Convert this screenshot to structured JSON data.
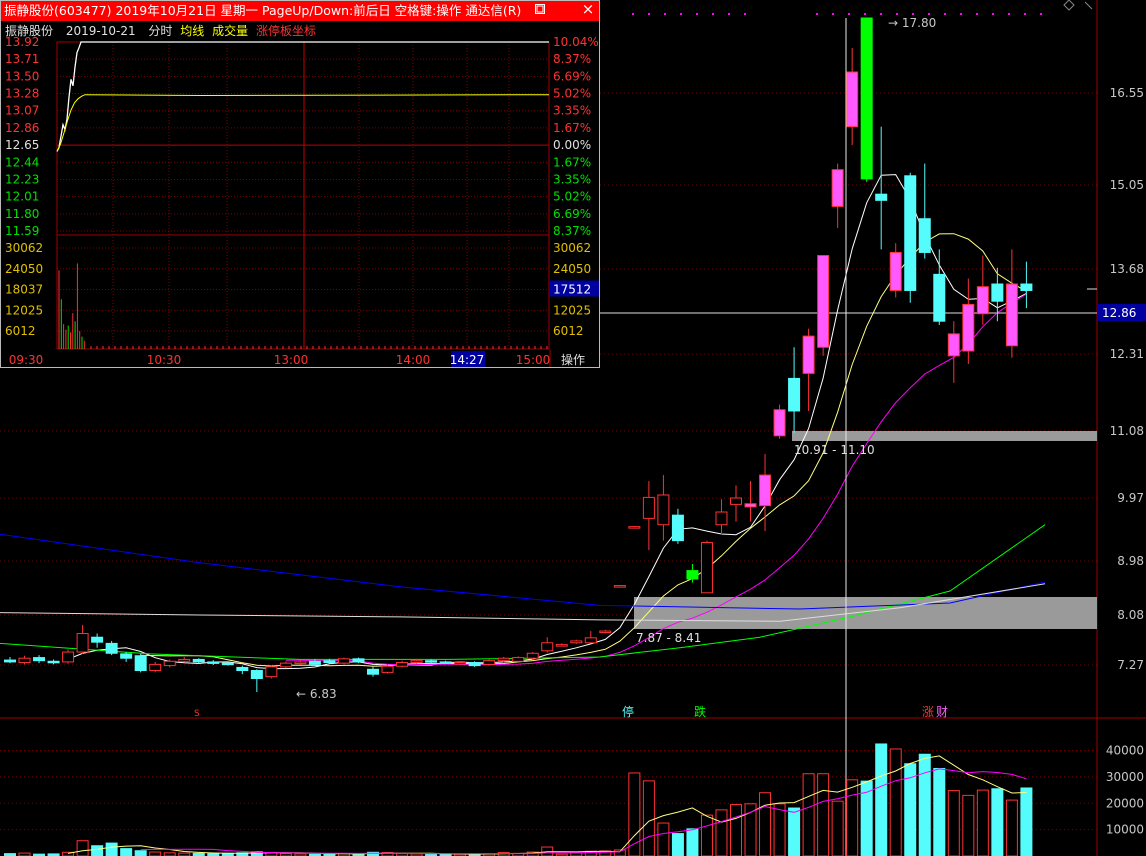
{
  "colors": {
    "up": "#ff3232",
    "up_fill": "#ff5aff",
    "down": "#54fcfc",
    "limit_up": "#00ff00",
    "grid": "#7a0000",
    "ma_white": "#ffffff",
    "ma_yellow": "#ffff80",
    "ma_magenta": "#ff00ff",
    "ma_green": "#00ff00",
    "ma_blue": "#0000ff",
    "axis_text": "#c8c8c8",
    "price_label_bg": "#0000a0",
    "zone_fill": "#9a9a9a"
  },
  "intraday": {
    "title": "振静股份(603477) 2019年10月21日 星期一 PageUp/Down:前后日 空格键:操作 通达信(R)",
    "min_icon": "restore-icon",
    "close_icon": "×",
    "subtitle": {
      "name": "振静股份",
      "date": "2019-10-21",
      "mode": "分时",
      "avg_line": "均线",
      "volume": "成交量",
      "limit_board": "涨停板坐标"
    },
    "prices_left": [
      "13.92",
      "13.71",
      "13.50",
      "13.28",
      "13.07",
      "12.86",
      "12.65",
      "12.44",
      "12.23",
      "12.01",
      "11.80",
      "11.59"
    ],
    "pcts_right": [
      "10.04%",
      "8.37%",
      "6.69%",
      "5.02%",
      "3.35%",
      "1.67%",
      "0.00%",
      "1.67%",
      "3.35%",
      "5.02%",
      "6.69%",
      "8.37%"
    ],
    "vol_left": [
      "30062",
      "24050",
      "18037",
      "12025",
      "6012"
    ],
    "vol_right": [
      "30062",
      "24050",
      "18037",
      "12025",
      "6012"
    ],
    "vol_cursor": "17512",
    "times": [
      "09:30",
      "10:30",
      "13:00",
      "14:00",
      "14:27",
      "15:00"
    ],
    "operate": "操作",
    "price_path": [
      12.57,
      12.62,
      12.76,
      12.9,
      12.84,
      12.97,
      13.24,
      13.46,
      13.38,
      13.61,
      13.79,
      13.85,
      13.92
    ],
    "avg_path": [
      12.57,
      12.66,
      12.8,
      12.95,
      13.08,
      13.17,
      13.22,
      13.25,
      13.27
    ],
    "vol_bars": [
      28500,
      18000,
      9000,
      7000,
      8500,
      6000,
      13000,
      10000,
      31000,
      6500,
      4500,
      3000
    ]
  },
  "kline": {
    "price_axis": [
      "16.55",
      "15.05",
      "13.68",
      "12.31",
      "11.08",
      "9.97",
      "8.98",
      "8.08",
      "7.27"
    ],
    "current_price": "12.86",
    "high_label": "17.80",
    "low_label": "6.83",
    "zone_upper_label": "10.91 - 11.10",
    "zone_lower_label": "7.87 - 8.41",
    "markers": [
      {
        "text": "S",
        "color": "#ff3232"
      },
      {
        "text": "停",
        "color": "#54fcfc"
      },
      {
        "text": "跌",
        "color": "#00ff00"
      },
      {
        "text": "涨",
        "color": "#ff3232"
      },
      {
        "text": "财",
        "color": "#ff5aff"
      }
    ],
    "volume_axis": [
      "40000",
      "30000",
      "20000",
      "10000"
    ],
    "candles": [
      {
        "o": 7.35,
        "c": 7.32,
        "h": 7.4,
        "l": 7.3
      },
      {
        "o": 7.31,
        "c": 7.38,
        "h": 7.42,
        "l": 7.28
      },
      {
        "o": 7.39,
        "c": 7.34,
        "h": 7.43,
        "l": 7.3
      },
      {
        "o": 7.33,
        "c": 7.31,
        "h": 7.36,
        "l": 7.28
      },
      {
        "o": 7.32,
        "c": 7.48,
        "h": 7.52,
        "l": 7.29
      },
      {
        "o": 7.48,
        "c": 7.78,
        "h": 7.92,
        "l": 7.45
      },
      {
        "o": 7.72,
        "c": 7.64,
        "h": 7.78,
        "l": 7.55
      },
      {
        "o": 7.62,
        "c": 7.46,
        "h": 7.66,
        "l": 7.43
      },
      {
        "o": 7.45,
        "c": 7.38,
        "h": 7.48,
        "l": 7.32
      },
      {
        "o": 7.42,
        "c": 7.18,
        "h": 7.45,
        "l": 7.15
      },
      {
        "o": 7.18,
        "c": 7.28,
        "h": 7.32,
        "l": 7.15
      },
      {
        "o": 7.26,
        "c": 7.33,
        "h": 7.36,
        "l": 7.23
      },
      {
        "o": 7.33,
        "c": 7.36,
        "h": 7.4,
        "l": 7.31
      },
      {
        "o": 7.36,
        "c": 7.32,
        "h": 7.38,
        "l": 7.29
      },
      {
        "o": 7.32,
        "c": 7.3,
        "h": 7.35,
        "l": 7.27
      },
      {
        "o": 7.3,
        "c": 7.29,
        "h": 7.33,
        "l": 7.26
      },
      {
        "o": 7.23,
        "c": 7.18,
        "h": 7.26,
        "l": 7.12
      },
      {
        "o": 7.18,
        "c": 7.05,
        "h": 7.2,
        "l": 6.83
      },
      {
        "o": 7.08,
        "c": 7.24,
        "h": 7.27,
        "l": 7.05
      },
      {
        "o": 7.24,
        "c": 7.3,
        "h": 7.33,
        "l": 7.22
      },
      {
        "o": 7.3,
        "c": 7.32,
        "h": 7.35,
        "l": 7.27
      },
      {
        "o": 7.33,
        "c": 7.28,
        "h": 7.36,
        "l": 7.26
      },
      {
        "o": 7.34,
        "c": 7.31,
        "h": 7.37,
        "l": 7.29
      },
      {
        "o": 7.3,
        "c": 7.37,
        "h": 7.39,
        "l": 7.28
      },
      {
        "o": 7.37,
        "c": 7.32,
        "h": 7.39,
        "l": 7.3
      },
      {
        "o": 7.2,
        "c": 7.12,
        "h": 7.24,
        "l": 7.08
      },
      {
        "o": 7.15,
        "c": 7.25,
        "h": 7.28,
        "l": 7.13
      },
      {
        "o": 7.25,
        "c": 7.31,
        "h": 7.34,
        "l": 7.23
      },
      {
        "o": 7.31,
        "c": 7.34,
        "h": 7.37,
        "l": 7.29
      },
      {
        "o": 7.34,
        "c": 7.32,
        "h": 7.36,
        "l": 7.3
      },
      {
        "o": 7.32,
        "c": 7.31,
        "h": 7.34,
        "l": 7.29
      },
      {
        "o": 7.3,
        "c": 7.31,
        "h": 7.33,
        "l": 7.28
      },
      {
        "o": 7.31,
        "c": 7.26,
        "h": 7.33,
        "l": 7.24
      },
      {
        "o": 7.28,
        "c": 7.34,
        "h": 7.36,
        "l": 7.26
      },
      {
        "o": 7.34,
        "c": 7.38,
        "h": 7.4,
        "l": 7.31
      },
      {
        "o": 7.33,
        "c": 7.39,
        "h": 7.41,
        "l": 7.32
      },
      {
        "o": 7.38,
        "c": 7.46,
        "h": 7.48,
        "l": 7.36
      },
      {
        "o": 7.5,
        "c": 7.63,
        "h": 7.72,
        "l": 7.47
      },
      {
        "o": 7.6,
        "c": 7.6,
        "h": 7.62,
        "l": 7.58
      },
      {
        "o": 7.63,
        "c": 7.66,
        "h": 7.68,
        "l": 7.61
      },
      {
        "o": 7.63,
        "c": 7.71,
        "h": 7.82,
        "l": 7.62
      },
      {
        "o": 7.8,
        "c": 7.82,
        "h": 7.84,
        "l": 7.78
      },
      {
        "o": 8.55,
        "c": 8.57,
        "h": 8.58,
        "l": 8.55
      },
      {
        "o": 9.5,
        "c": 9.52,
        "h": 9.53,
        "l": 9.5
      },
      {
        "o": 9.65,
        "c": 9.98,
        "h": 10.25,
        "l": 9.15
      },
      {
        "o": 9.55,
        "c": 10.02,
        "h": 10.35,
        "l": 9.3
      },
      {
        "o": 9.7,
        "c": 9.3,
        "h": 9.8,
        "l": 9.25
      },
      {
        "o": 8.82,
        "c": 8.68,
        "h": 8.93,
        "l": 8.62
      },
      {
        "o": 8.45,
        "c": 9.27,
        "h": 9.3,
        "l": 8.45
      },
      {
        "o": 9.55,
        "c": 9.75,
        "h": 9.95,
        "l": 9.4
      },
      {
        "o": 9.87,
        "c": 9.97,
        "h": 10.18,
        "l": 9.6
      },
      {
        "o": 9.83,
        "c": 9.88,
        "h": 10.25,
        "l": 9.6
      },
      {
        "o": 9.85,
        "c": 10.35,
        "h": 10.7,
        "l": 9.45
      },
      {
        "o": 11.0,
        "c": 11.42,
        "h": 11.5,
        "l": 10.95
      },
      {
        "o": 11.92,
        "c": 11.4,
        "h": 12.4,
        "l": 11.05
      },
      {
        "o": 12.0,
        "c": 12.55,
        "h": 12.65,
        "l": 11.4
      },
      {
        "o": 12.4,
        "c": 13.9,
        "h": 13.9,
        "l": 12.28
      },
      {
        "o": 14.7,
        "c": 15.3,
        "h": 15.4,
        "l": 14.35
      },
      {
        "o": 16.0,
        "c": 16.9,
        "h": 17.3,
        "l": 15.7
      },
      {
        "o": 17.8,
        "c": 15.15,
        "h": 17.8,
        "l": 15.1
      },
      {
        "o": 14.9,
        "c": 14.8,
        "h": 16.0,
        "l": 14.0
      },
      {
        "o": 13.28,
        "c": 13.95,
        "h": 14.1,
        "l": 13.15
      },
      {
        "o": 15.2,
        "c": 13.28,
        "h": 15.25,
        "l": 13.05
      },
      {
        "o": 14.5,
        "c": 13.95,
        "h": 15.4,
        "l": 13.85
      },
      {
        "o": 13.58,
        "c": 12.75,
        "h": 14.0,
        "l": 12.7
      },
      {
        "o": 12.28,
        "c": 12.58,
        "h": 12.75,
        "l": 11.85
      },
      {
        "o": 12.35,
        "c": 13.02,
        "h": 13.5,
        "l": 12.15
      },
      {
        "o": 12.85,
        "c": 13.35,
        "h": 13.9,
        "l": 12.7
      },
      {
        "o": 13.4,
        "c": 13.08,
        "h": 13.7,
        "l": 12.75
      },
      {
        "o": 12.42,
        "c": 13.4,
        "h": 14.0,
        "l": 12.25
      },
      {
        "o": 13.4,
        "c": 13.28,
        "h": 13.8,
        "l": 12.95
      }
    ],
    "volumes": [
      900,
      1100,
      700,
      800,
      1400,
      5800,
      3900,
      4900,
      2800,
      2000,
      1500,
      1200,
      1100,
      1000,
      900,
      1000,
      1200,
      1600,
      1300,
      900,
      800,
      700,
      800,
      900,
      850,
      1400,
      1300,
      900,
      800,
      700,
      650,
      700,
      800,
      900,
      1300,
      1000,
      1500,
      3400,
      700,
      1200,
      1800,
      1900,
      2300,
      31500,
      28500,
      12500,
      8500,
      10300,
      15500,
      17500,
      19500,
      19800,
      24000,
      19800,
      18200,
      31200,
      31200,
      20800,
      28900,
      28400,
      42500,
      40600,
      35000,
      38600,
      33200,
      24800,
      23000,
      25000,
      25500,
      21200,
      25800
    ]
  }
}
